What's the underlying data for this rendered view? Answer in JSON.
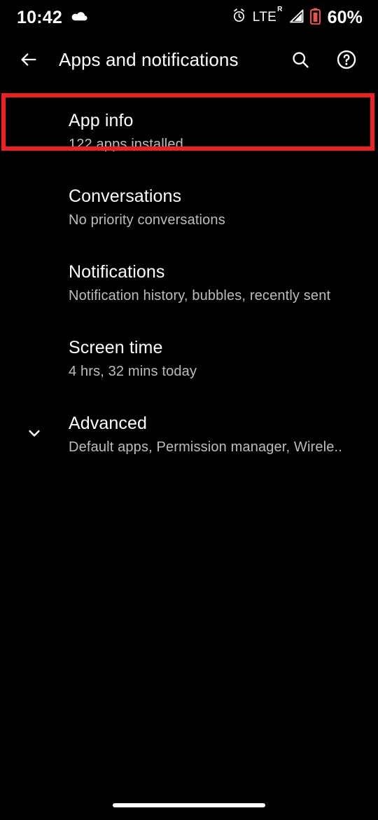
{
  "status_bar": {
    "time": "10:42",
    "weather_icon": "cloud-icon",
    "alarm_icon": "alarm-clock-icon",
    "network_type": "LTE",
    "roaming_superscript": "R",
    "signal_icon": "signal-bars-icon",
    "battery_icon": "battery-low-icon",
    "battery_percent": "60%",
    "battery_icon_color": "#e5554f"
  },
  "toolbar": {
    "back_icon": "back-arrow-icon",
    "title": "Apps and notifications",
    "search_icon": "search-icon",
    "help_icon": "help-circle-icon"
  },
  "list": {
    "items": [
      {
        "title": "App info",
        "subtitle": "122 apps installed",
        "lead_icon": "",
        "highlighted": true
      },
      {
        "title": "Conversations",
        "subtitle": "No priority conversations",
        "lead_icon": "",
        "highlighted": false
      },
      {
        "title": "Notifications",
        "subtitle": "Notification history, bubbles, recently sent",
        "lead_icon": "",
        "highlighted": false
      },
      {
        "title": "Screen time",
        "subtitle": "4 hrs, 32 mins today",
        "lead_icon": "",
        "highlighted": false
      },
      {
        "title": "Advanced",
        "subtitle": "Default apps, Permission manager, Wirele..",
        "lead_icon": "chevron-down-icon",
        "highlighted": false
      }
    ]
  },
  "annotation": {
    "target": "App info",
    "color": "#ee2023"
  },
  "navigation": {
    "gesture_pill": "home-gesture-pill"
  },
  "theme": {
    "background": "#000000",
    "primary_text": "#ffffff",
    "secondary_text": "#bdbdbd"
  }
}
